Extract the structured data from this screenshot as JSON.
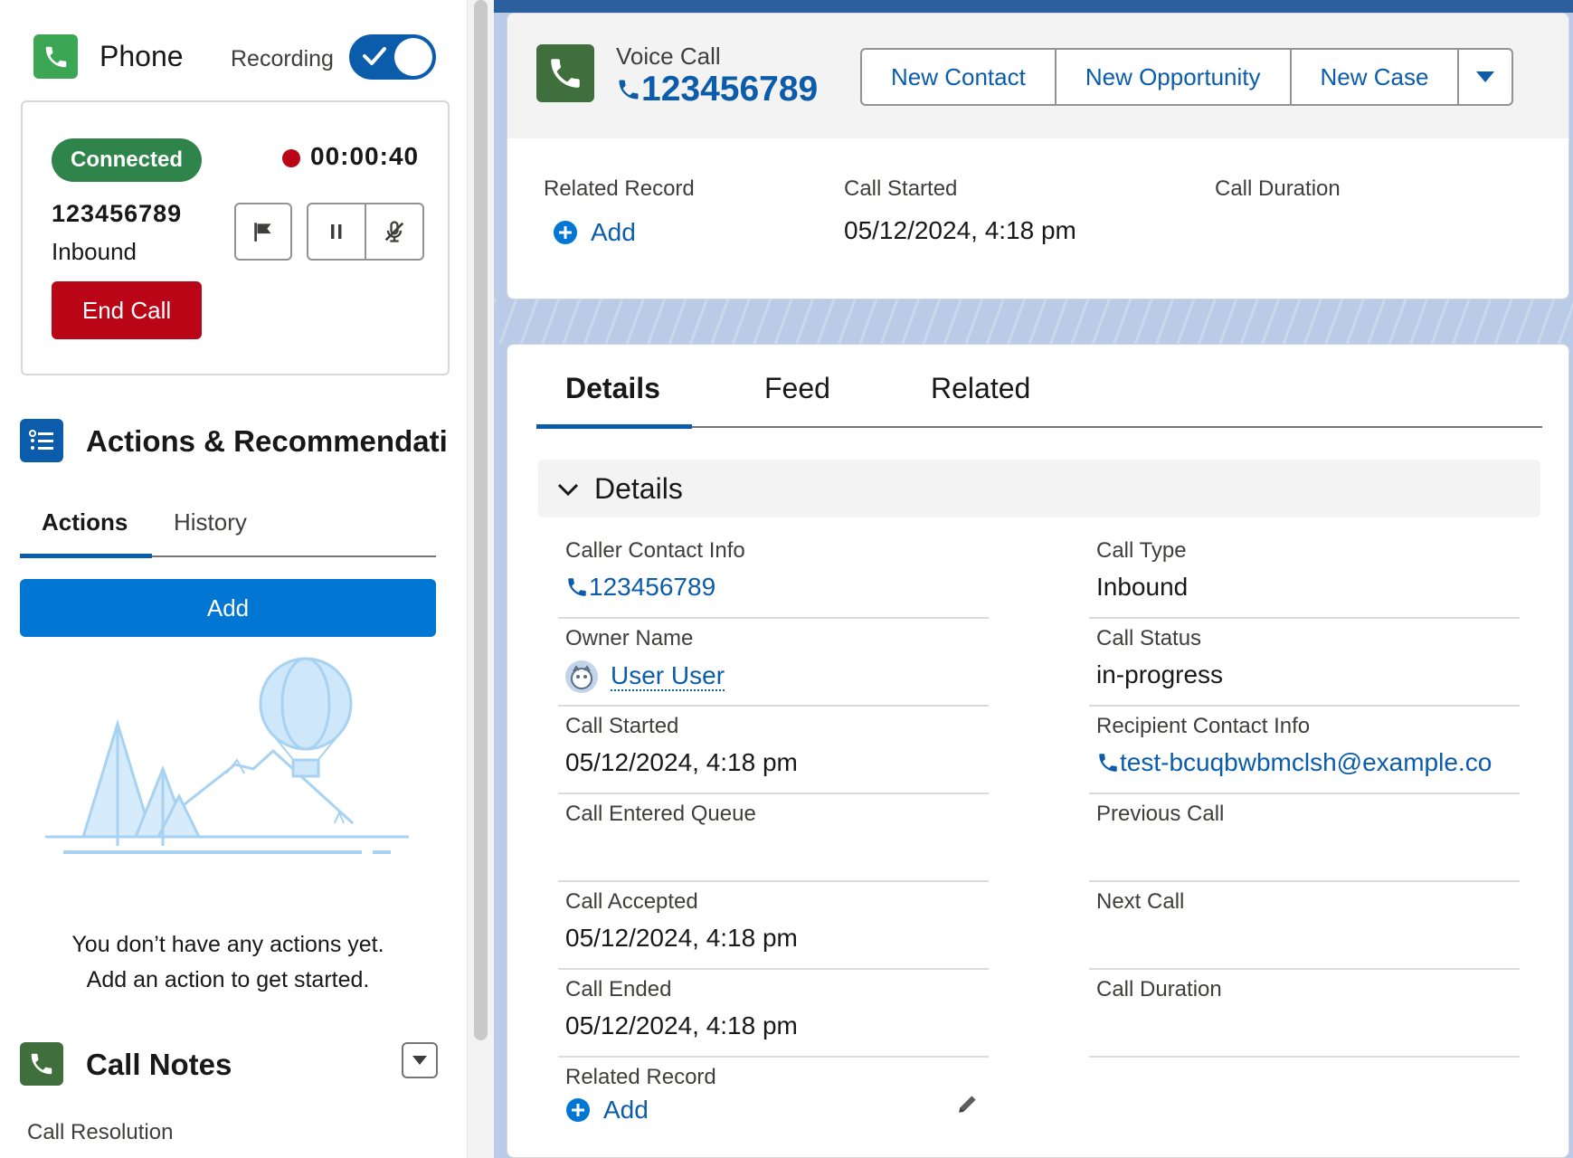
{
  "phone": {
    "title": "Phone",
    "recording_label": "Recording",
    "status": "Connected",
    "timer": "00:00:40",
    "number": "123456789",
    "direction": "Inbound",
    "end_call_label": "End Call"
  },
  "actions": {
    "title": "Actions & Recommendati",
    "tabs": [
      {
        "label": "Actions"
      },
      {
        "label": "History"
      }
    ],
    "add_label": "Add",
    "empty_line1": "You don’t have any actions yet.",
    "empty_line2": "Add an action to get started."
  },
  "call_notes": {
    "title": "Call Notes",
    "field_label": "Call Resolution"
  },
  "record": {
    "type_label": "Voice Call",
    "number": "123456789",
    "buttons": [
      {
        "label": "New Contact"
      },
      {
        "label": "New Opportunity"
      },
      {
        "label": "New Case"
      }
    ],
    "highlights": {
      "related_record_label": "Related Record",
      "related_record_add": "Add",
      "call_started_label": "Call Started",
      "call_started_value": "05/12/2024, 4:18 pm",
      "call_duration_label": "Call Duration"
    }
  },
  "tabs": [
    {
      "label": "Details"
    },
    {
      "label": "Feed"
    },
    {
      "label": "Related"
    }
  ],
  "section": {
    "title": "Details"
  },
  "fields": {
    "caller_contact_info": {
      "label": "Caller Contact Info",
      "value": "123456789"
    },
    "call_type": {
      "label": "Call Type",
      "value": "Inbound"
    },
    "owner_name": {
      "label": "Owner Name",
      "value": "User User"
    },
    "call_status": {
      "label": "Call Status",
      "value": "in-progress"
    },
    "call_started": {
      "label": "Call Started",
      "value": "05/12/2024, 4:18 pm"
    },
    "recipient_contact_info": {
      "label": "Recipient Contact Info",
      "value": "test-bcuqbwbmclsh@example.co"
    },
    "call_entered_queue": {
      "label": "Call Entered Queue",
      "value": ""
    },
    "previous_call": {
      "label": "Previous Call",
      "value": ""
    },
    "call_accepted": {
      "label": "Call Accepted",
      "value": "05/12/2024, 4:18 pm"
    },
    "next_call": {
      "label": "Next Call",
      "value": ""
    },
    "call_ended": {
      "label": "Call Ended",
      "value": "05/12/2024, 4:18 pm"
    },
    "call_duration": {
      "label": "Call Duration",
      "value": ""
    },
    "related_record": {
      "label": "Related Record",
      "add": "Add"
    }
  },
  "colors": {
    "brand_blue": "#0176d3",
    "link_blue": "#0b5cab",
    "success_green": "#2e844a",
    "danger_red": "#ba0517"
  },
  "icons": [
    "phone-icon",
    "check-icon",
    "flag-icon",
    "pause-icon",
    "mute-icon",
    "list-icon",
    "chevron-down-icon",
    "plus-circle-icon",
    "pencil-icon",
    "avatar-icon",
    "balloon-illustration"
  ]
}
